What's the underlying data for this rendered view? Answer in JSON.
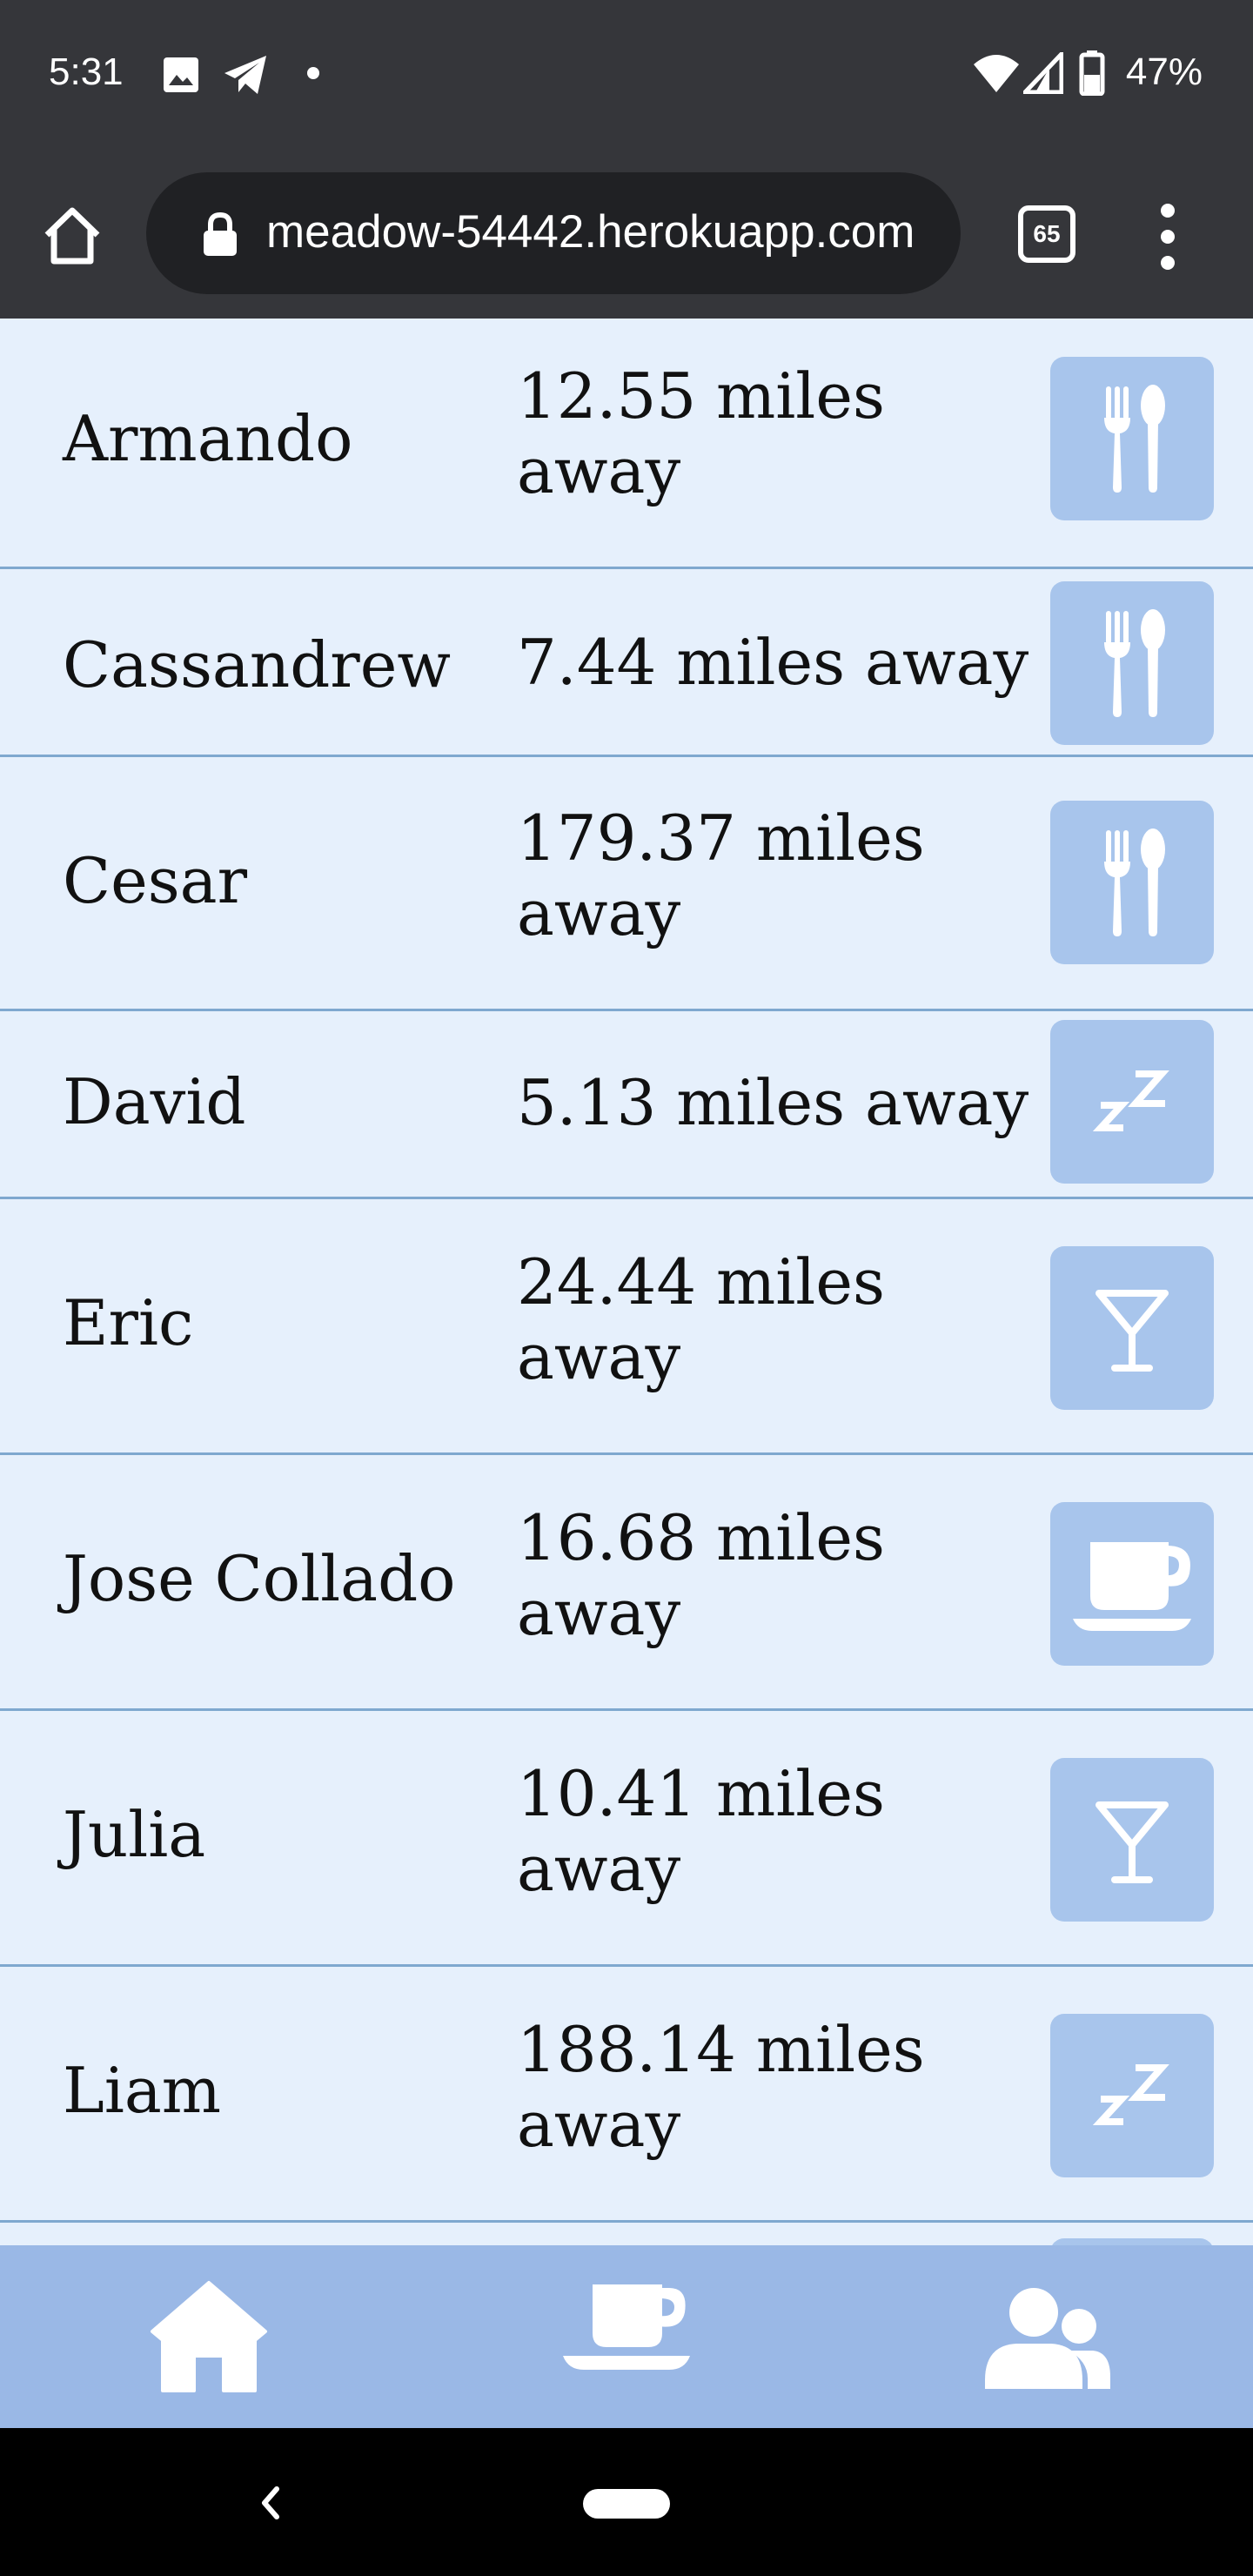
{
  "status_bar": {
    "time": "5:31",
    "battery": "47%"
  },
  "browser": {
    "url": "meadow-54442.herokuapp.com",
    "tab_count": "65"
  },
  "people": [
    {
      "name": "Armando",
      "distance": "12.55 miles away",
      "activity_icon": "utensils-icon"
    },
    {
      "name": "Cassandrew",
      "distance": "7.44 miles away",
      "activity_icon": "utensils-icon"
    },
    {
      "name": "Cesar",
      "distance": "179.37 miles away",
      "activity_icon": "utensils-icon"
    },
    {
      "name": "David",
      "distance": "5.13 miles away",
      "activity_icon": "sleep-zz-icon"
    },
    {
      "name": "Eric",
      "distance": "24.44 miles away",
      "activity_icon": "cocktail-icon"
    },
    {
      "name": "Jose Collado",
      "distance": "16.68 miles away",
      "activity_icon": "coffee-cup-icon"
    },
    {
      "name": "Julia",
      "distance": "10.41 miles away",
      "activity_icon": "cocktail-icon"
    },
    {
      "name": "Liam",
      "distance": "188.14 miles away",
      "activity_icon": "sleep-zz-icon"
    }
  ],
  "bottom_nav": {
    "items": [
      "home-icon",
      "coffee-cup-icon",
      "users-icon"
    ]
  },
  "colors": {
    "background": "#e6f0fc",
    "icon_tile": "#a8c5ec",
    "bottom_nav": "#9ab8e6",
    "divider": "#7fa8cf",
    "chrome": "#35363a"
  }
}
